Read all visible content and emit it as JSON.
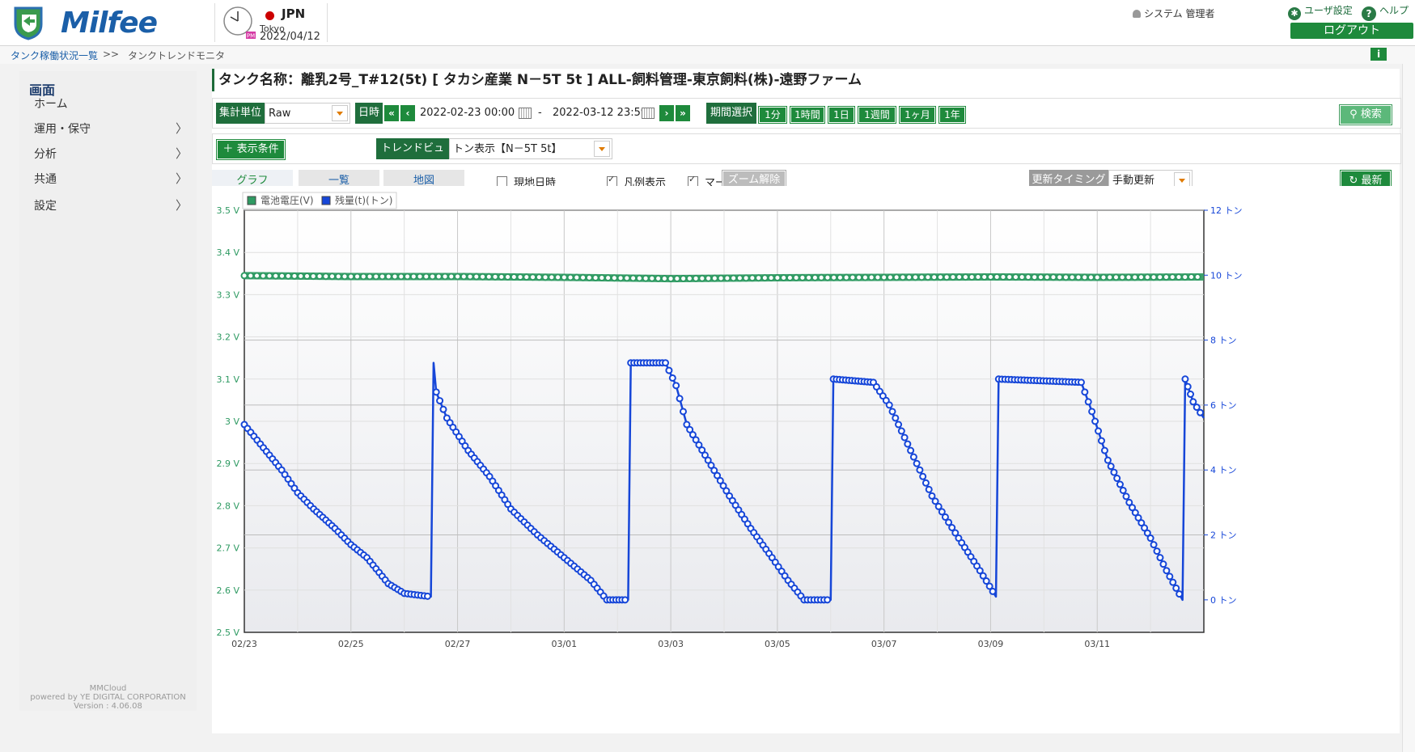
{
  "header": {
    "brand": "Milfee",
    "country": "JPN",
    "city": "Tokyo",
    "date": "2022/04/12",
    "clock_badge": "PM",
    "user": "システム 管理者",
    "user_settings": "ユーザ設定",
    "help": "ヘルプ",
    "logout": "ログアウト"
  },
  "breadcrumb": {
    "parent": "タンク稼働状況一覧",
    "sep": ">>",
    "current": "タンクトレンドモニタ",
    "info": "i"
  },
  "sidebar": {
    "title": "画面",
    "items": [
      {
        "label": "ホーム",
        "chevron": false
      },
      {
        "label": "運用・保守",
        "chevron": true
      },
      {
        "label": "分析",
        "chevron": true
      },
      {
        "label": "共通",
        "chevron": true
      },
      {
        "label": "設定",
        "chevron": true
      }
    ],
    "footer": [
      "MMCloud",
      "powered by YE DIGITAL CORPORATION",
      "Version : 4.06.08"
    ]
  },
  "tank_title": "タンク名称：離乳2号_T#12(5t) [ タカシ産業 N－5T 5t ] ALL-飼料管理-東京飼料(株)-遠野ファーム",
  "controls": {
    "unit_label": "集計単位",
    "unit_value": "Raw",
    "datetime_label": "日時",
    "nav_first": "«",
    "nav_prev": "‹",
    "nav_next": "›",
    "nav_last": "»",
    "from": "2022-02-23 00:00",
    "dash": "-",
    "to": "2022-03-12 23:59",
    "period_label": "期間選択",
    "periods": [
      "1分",
      "1時間",
      "1日",
      "1週間",
      "1ヶ月",
      "1年"
    ],
    "search": "検索",
    "conditions": "表示条件",
    "trend_view_label": "トレンドビュー",
    "trend_view_value": "トン表示【N－5T 5t】"
  },
  "tabs": [
    "グラフ",
    "一覧",
    "地図"
  ],
  "options": {
    "local_datetime": {
      "label": "現地日時",
      "checked": false
    },
    "legend": {
      "label": "凡例表示",
      "checked": true
    },
    "marker": {
      "label": "マーカー表示",
      "checked": true
    },
    "zoom_reset": "ズーム解除",
    "timing_label": "更新タイミング",
    "timing_value": "手動更新",
    "refresh": "最新"
  },
  "chart_data": {
    "type": "line",
    "title": "",
    "legend_position": "top-left",
    "grid": true,
    "x": {
      "ticks": [
        "02/23",
        "02/25",
        "02/27",
        "03/01",
        "03/03",
        "03/05",
        "03/07",
        "03/09",
        "03/11"
      ],
      "range_days": [
        0,
        18
      ]
    },
    "y_left": {
      "label_suffix": " V",
      "min": 2.5,
      "max": 3.5,
      "ticks": [
        "2.5 V",
        "2.6 V",
        "2.7 V",
        "2.8 V",
        "2.9 V",
        "3 V",
        "3.1 V",
        "3.2 V",
        "3.3 V",
        "3.4 V",
        "3.5 V"
      ]
    },
    "y_right": {
      "min": -1,
      "max": 12,
      "ticks": [
        "0 トン",
        "2 トン",
        "4 トン",
        "6 トン",
        "8 トン",
        "10 トン",
        "12 トン"
      ]
    },
    "series": [
      {
        "name": "電池電圧(V)",
        "axis": "left",
        "color": "#2e9a62",
        "points": [
          [
            0,
            3.345
          ],
          [
            2,
            3.343
          ],
          [
            4,
            3.343
          ],
          [
            6,
            3.341
          ],
          [
            8,
            3.338
          ],
          [
            10,
            3.34
          ],
          [
            12,
            3.341
          ],
          [
            14,
            3.342
          ],
          [
            16,
            3.341
          ],
          [
            18,
            3.342
          ]
        ]
      },
      {
        "name": "残量(t)(トン)",
        "axis": "right",
        "color": "#1646d8",
        "points": [
          [
            0.0,
            5.4
          ],
          [
            0.3,
            4.8
          ],
          [
            0.7,
            4.0
          ],
          [
            1.0,
            3.3
          ],
          [
            1.3,
            2.8
          ],
          [
            1.7,
            2.2
          ],
          [
            2.0,
            1.7
          ],
          [
            2.3,
            1.3
          ],
          [
            2.7,
            0.5
          ],
          [
            3.0,
            0.2
          ],
          [
            3.5,
            0.1
          ],
          [
            3.55,
            7.3
          ],
          [
            3.6,
            6.4
          ],
          [
            3.8,
            5.6
          ],
          [
            4.2,
            4.6
          ],
          [
            4.6,
            3.8
          ],
          [
            5.0,
            2.8
          ],
          [
            5.5,
            2.0
          ],
          [
            6.0,
            1.3
          ],
          [
            6.5,
            0.6
          ],
          [
            6.8,
            0.0
          ],
          [
            7.2,
            0.0
          ],
          [
            7.25,
            7.3
          ],
          [
            7.9,
            7.3
          ],
          [
            8.1,
            6.6
          ],
          [
            8.3,
            5.4
          ],
          [
            8.7,
            4.3
          ],
          [
            9.1,
            3.2
          ],
          [
            9.5,
            2.2
          ],
          [
            9.9,
            1.3
          ],
          [
            10.2,
            0.6
          ],
          [
            10.5,
            0.0
          ],
          [
            11.0,
            0.0
          ],
          [
            11.05,
            6.8
          ],
          [
            11.8,
            6.7
          ],
          [
            12.1,
            6.0
          ],
          [
            12.5,
            4.6
          ],
          [
            12.9,
            3.2
          ],
          [
            13.4,
            1.9
          ],
          [
            13.8,
            0.9
          ],
          [
            14.1,
            0.1
          ],
          [
            14.15,
            6.8
          ],
          [
            15.7,
            6.7
          ],
          [
            15.9,
            5.8
          ],
          [
            16.2,
            4.3
          ],
          [
            16.6,
            3.0
          ],
          [
            17.0,
            1.9
          ],
          [
            17.3,
            0.9
          ],
          [
            17.6,
            0.0
          ],
          [
            17.65,
            6.8
          ],
          [
            17.8,
            6.1
          ],
          [
            18.0,
            5.6
          ]
        ]
      }
    ]
  }
}
